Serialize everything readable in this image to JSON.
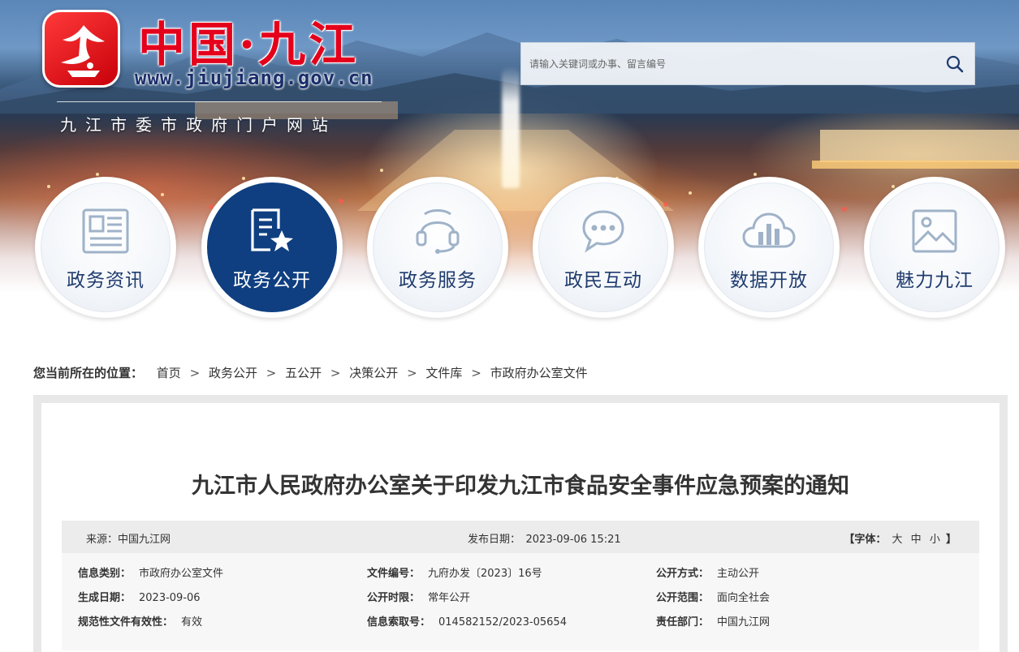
{
  "header": {
    "site_title": "中国·九江",
    "site_url": "www.jiujiang.gov.cn",
    "site_subtitle": "九江市委市政府门户网站",
    "search_placeholder": "请输入关键词或办事、留言编号",
    "brand_red": "#e4001b",
    "brand_blue": "#0f3f80"
  },
  "nav": {
    "items": [
      {
        "label": "政务资讯",
        "icon": "newspaper-icon",
        "active": false
      },
      {
        "label": "政务公开",
        "icon": "document-star-icon",
        "active": true
      },
      {
        "label": "政务服务",
        "icon": "headset-icon",
        "active": false
      },
      {
        "label": "政民互动",
        "icon": "chat-icon",
        "active": false
      },
      {
        "label": "数据开放",
        "icon": "cloud-chart-icon",
        "active": false
      },
      {
        "label": "魅力九江",
        "icon": "image-icon",
        "active": false
      }
    ]
  },
  "breadcrumb": {
    "label": "您当前所在的位置：",
    "items": [
      "首页",
      "政务公开",
      "五公开",
      "决策公开",
      "文件库",
      "市政府办公室文件"
    ],
    "separator": ">"
  },
  "article": {
    "title": "九江市人民政府办公室关于印发九江市食品安全事件应急预案的通知",
    "source": "来源：中国九江网",
    "publish_date": "发布日期：　2023-09-06 15:21",
    "font_size": {
      "open": "【字体：",
      "large": "大",
      "medium": "中",
      "small": "小",
      "close": "】"
    },
    "info": [
      [
        {
          "k": "信息类别：",
          "v": "市政府办公室文件"
        },
        {
          "k": "文件编号：",
          "v": "九府办发〔2023〕16号"
        },
        {
          "k": "公开方式：",
          "v": "主动公开"
        }
      ],
      [
        {
          "k": "生成日期：",
          "v": "2023-09-06"
        },
        {
          "k": "公开时限：",
          "v": "常年公开"
        },
        {
          "k": "公开范围：",
          "v": "面向全社会"
        }
      ],
      [
        {
          "k": "规范性文件有效性：",
          "v": "有效"
        },
        {
          "k": "信息索取号：",
          "v": "014582152/2023-05654"
        },
        {
          "k": "责任部门：",
          "v": "中国九江网"
        }
      ]
    ]
  }
}
